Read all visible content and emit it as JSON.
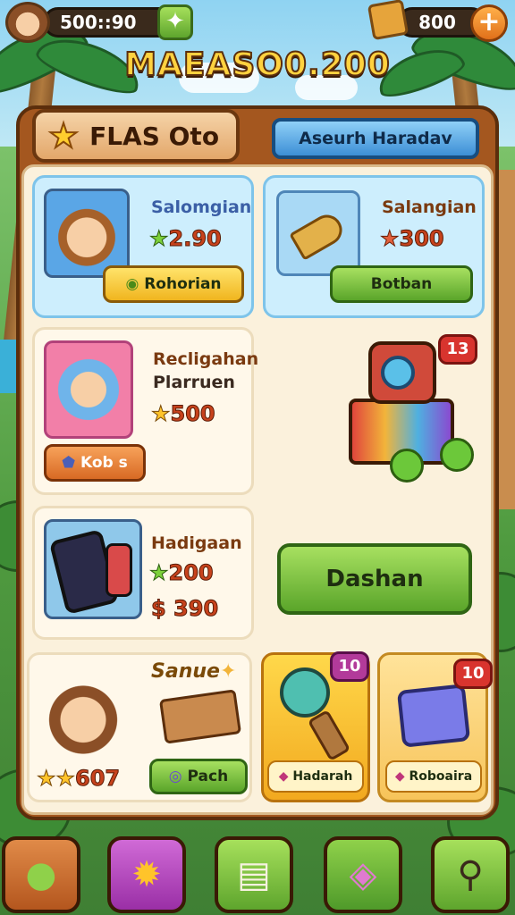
{
  "topbar": {
    "coins": "500::90",
    "gems": "800",
    "plus_label": "+"
  },
  "game_title": "MAEASO0.200",
  "header": {
    "title": "FLAS Oto",
    "search_label": "Aseurh Haradav"
  },
  "cards": {
    "c1": {
      "name": "Salomgian",
      "price": "2.90",
      "button": "Rohorian"
    },
    "c2": {
      "name": "Salangian",
      "price": "300",
      "button": "Botban"
    },
    "c3": {
      "name1": "Recligahan",
      "name2": "Plarruen",
      "price": "500",
      "button": "Kob s"
    },
    "c4": {
      "badge": "13"
    },
    "c5": {
      "name": "Hadigaan",
      "price1": "200",
      "price2": "$ 390"
    },
    "c6": {
      "button": "Dashan"
    },
    "c7": {
      "script": "Sanue",
      "price": "607",
      "button": "Pach"
    },
    "c8": {
      "badge": "10",
      "label": "Hadarah"
    },
    "c9": {
      "badge": "10",
      "label": "Roboaira"
    }
  },
  "nav": [
    {
      "name": "map-nav",
      "icon": "magnifier-leaf-icon",
      "color": "#c8692c"
    },
    {
      "name": "sun-nav",
      "icon": "sun-icon",
      "color": "#b24bb8"
    },
    {
      "name": "book-nav",
      "icon": "book-icon",
      "color": "#7cc03c"
    },
    {
      "name": "candy-nav",
      "icon": "candy-icon",
      "color": "#5cae3a"
    },
    {
      "name": "search-nav",
      "icon": "search-icon",
      "color": "#6cbc3a"
    }
  ]
}
